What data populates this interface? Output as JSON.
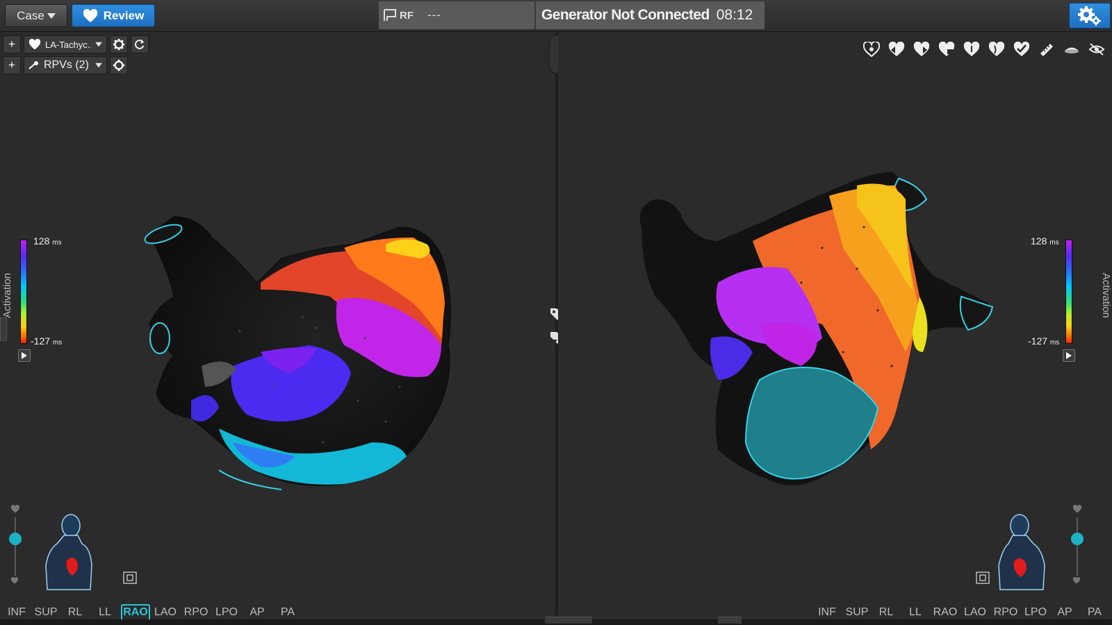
{
  "topbar": {
    "case_label": "Case",
    "review_label": "Review",
    "rf_label": "RF",
    "rf_value": "---",
    "generator_status": "Generator Not Connected",
    "time": "08:12"
  },
  "left_pane": {
    "map_select": "LA-Tachyc...",
    "sub_select": "RPVs (2)",
    "legend": {
      "max": "128",
      "min": "-127",
      "unit": "ms"
    },
    "side_label": "Activation",
    "views": [
      "INF",
      "SUP",
      "RL",
      "LL",
      "RAO",
      "LAO",
      "RPO",
      "LPO",
      "AP",
      "PA"
    ],
    "active_view": "RAO"
  },
  "right_pane": {
    "legend": {
      "max": "128",
      "min": "-127",
      "unit": "ms"
    },
    "side_label": "Activation",
    "views": [
      "INF",
      "SUP",
      "RL",
      "LL",
      "RAO",
      "LAO",
      "RPO",
      "LPO",
      "AP",
      "PA"
    ],
    "tool_icons": [
      "heart-outline-icon",
      "heart-arrow-left-icon",
      "heart-arrow-right-icon",
      "heart-lock-icon",
      "heart-icon",
      "heart-small-icon",
      "heart-check-icon",
      "ruler-icon",
      "cap-icon",
      "eye-off-icon"
    ]
  },
  "colors": {
    "accent_blue": "#2a86d8",
    "cyan": "#29c4d8",
    "background": "#2b2b2b"
  }
}
